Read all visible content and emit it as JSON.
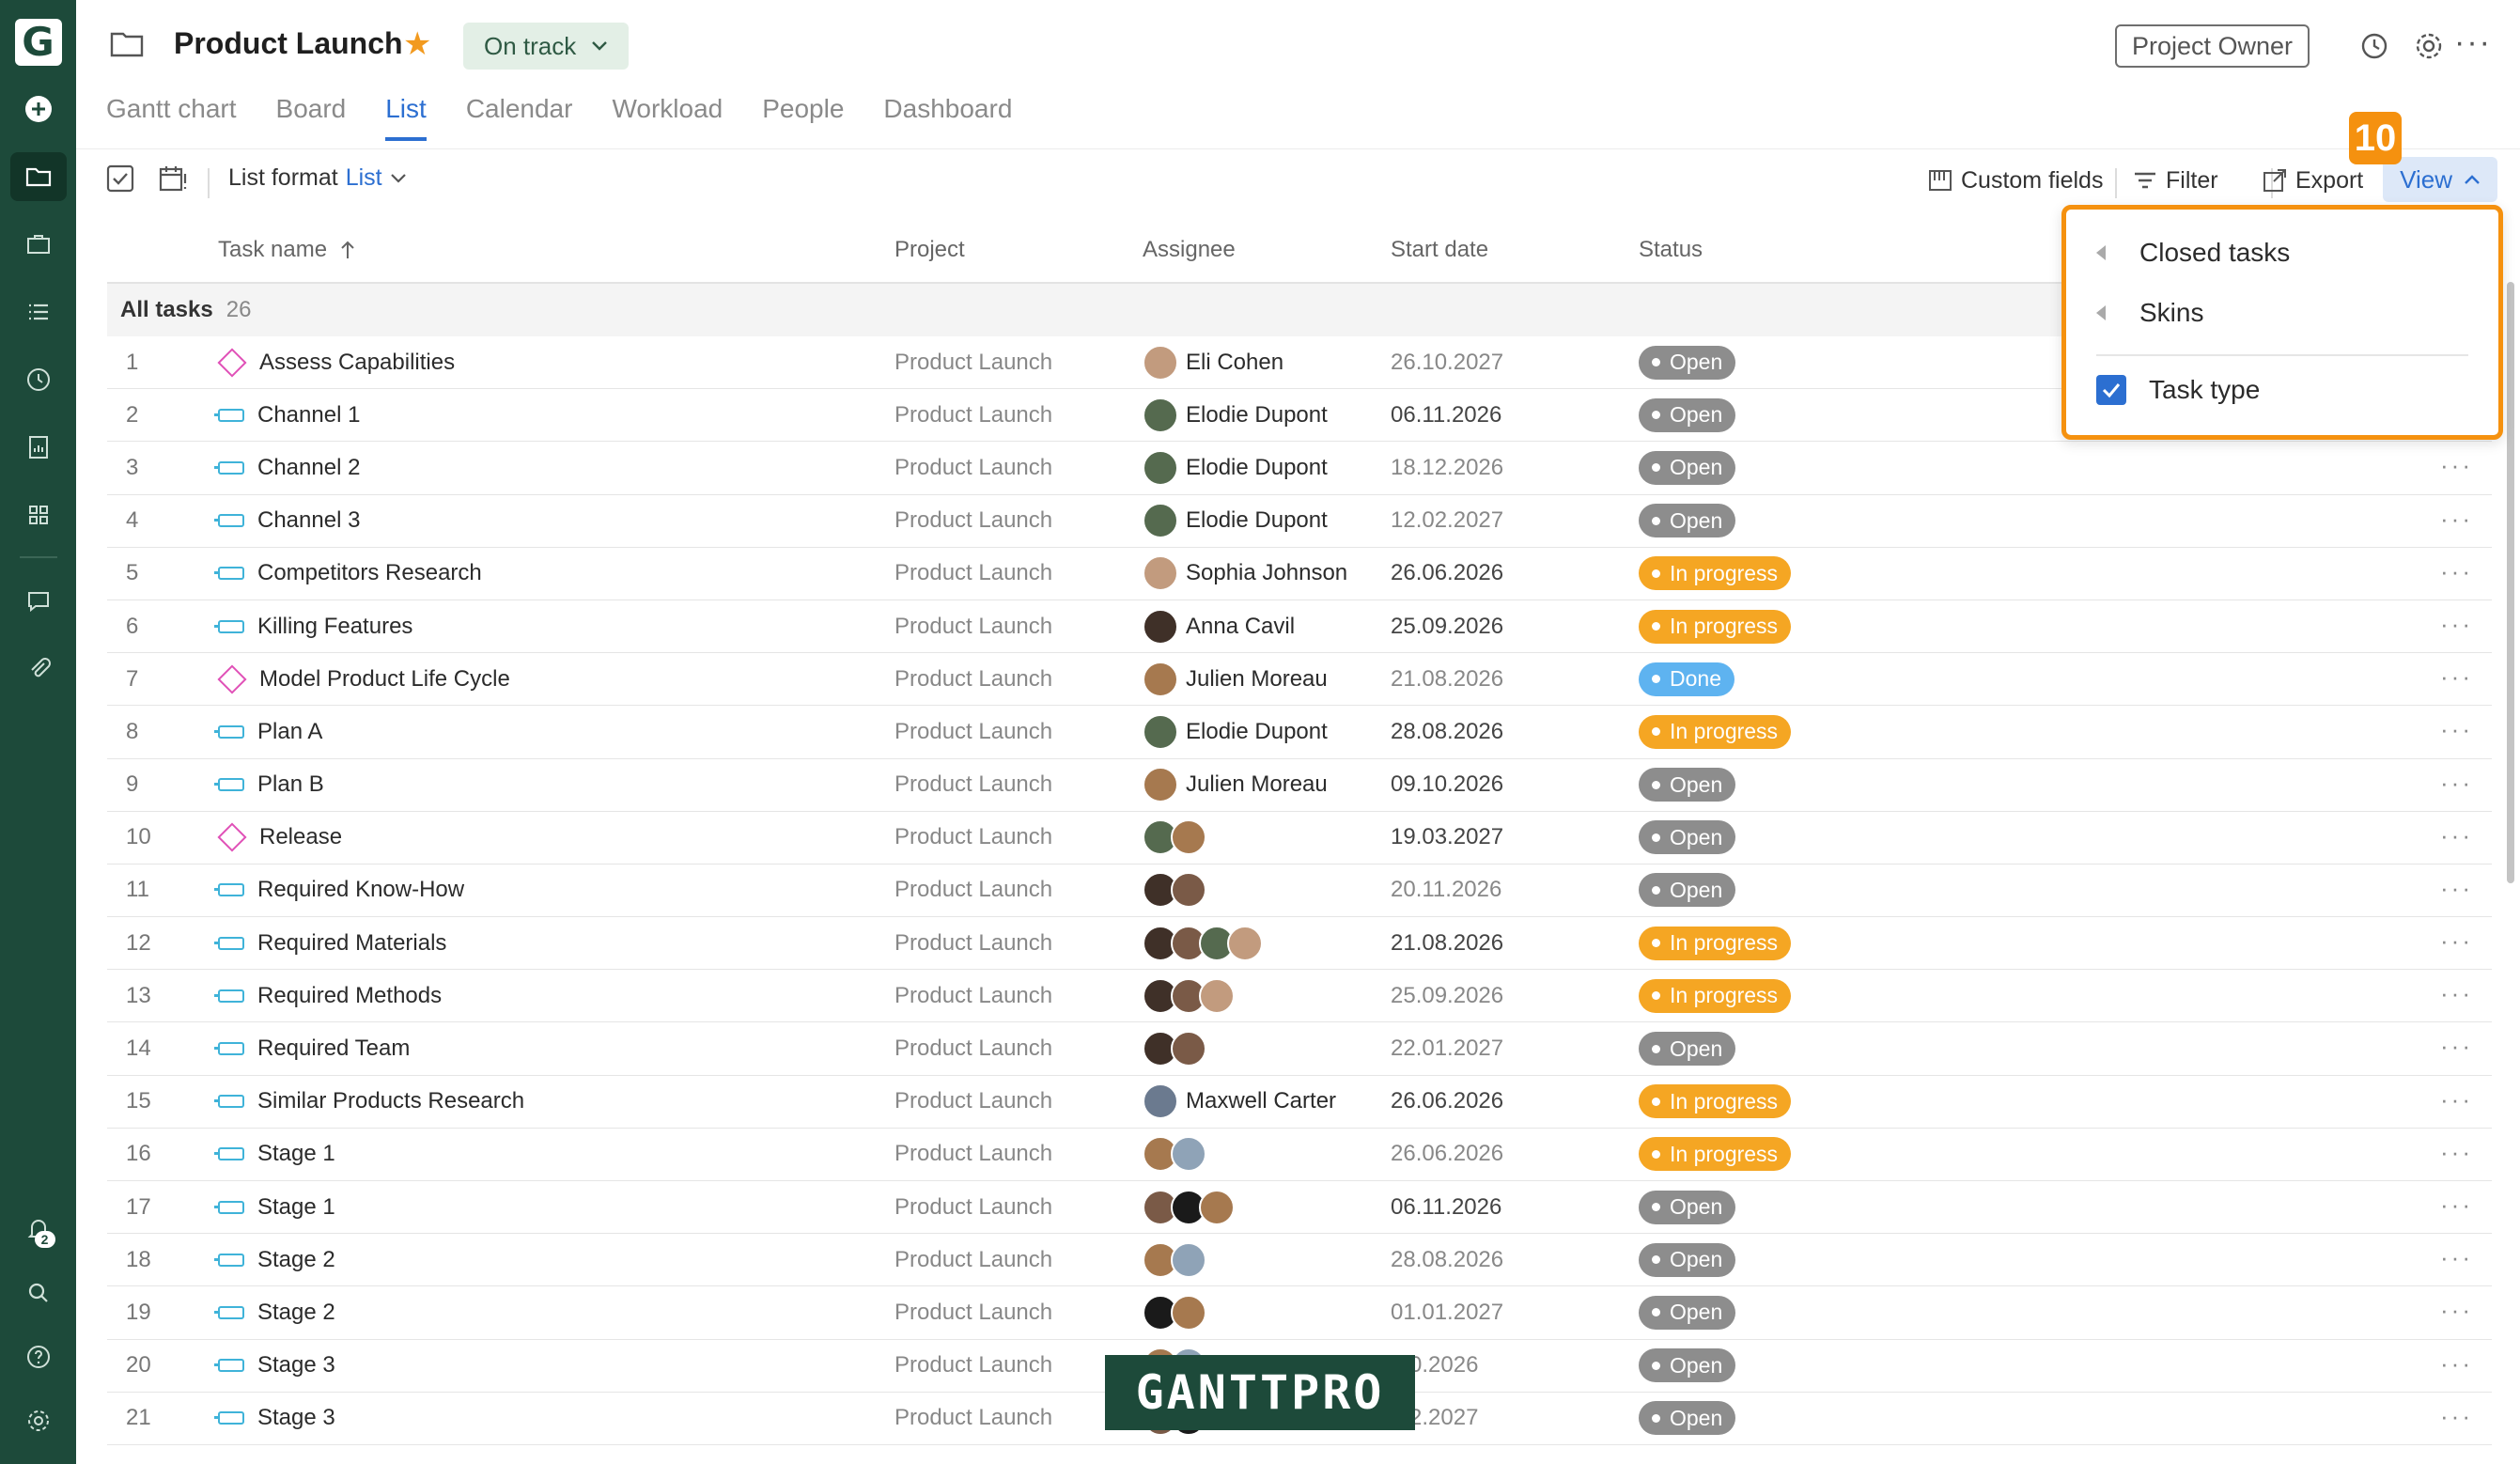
{
  "header": {
    "project_title": "Product Launch",
    "status": "On track",
    "owner_button": "Project Owner"
  },
  "tabs": [
    {
      "label": "Gantt chart",
      "active": false
    },
    {
      "label": "Board",
      "active": false
    },
    {
      "label": "List",
      "active": true
    },
    {
      "label": "Calendar",
      "active": false
    },
    {
      "label": "Workload",
      "active": false
    },
    {
      "label": "People",
      "active": false
    },
    {
      "label": "Dashboard",
      "active": false
    }
  ],
  "toolbar": {
    "list_format_label": "List format",
    "list_format_value": "List",
    "custom_fields": "Custom fields",
    "filter": "Filter",
    "export": "Export",
    "view": "View",
    "step_badge": "10"
  },
  "columns": {
    "task_name": "Task name",
    "project": "Project",
    "assignee": "Assignee",
    "start_date": "Start date",
    "status": "Status"
  },
  "group": {
    "label": "All tasks",
    "count": "26"
  },
  "rows": [
    {
      "num": "1",
      "type": "milestone",
      "name": "Assess Capabilities",
      "project": "Product Launch",
      "assignee": "Eli Cohen",
      "avatars": [
        "a3"
      ],
      "date": "26.10.2027",
      "date_dim": true,
      "status": "Open",
      "status_kind": "open"
    },
    {
      "num": "2",
      "type": "task",
      "name": "Channel 1",
      "project": "Product Launch",
      "assignee": "Elodie Dupont",
      "avatars": [
        "a2"
      ],
      "date": "06.11.2026",
      "date_dim": false,
      "status": "Open",
      "status_kind": "open"
    },
    {
      "num": "3",
      "type": "task",
      "name": "Channel 2",
      "project": "Product Launch",
      "assignee": "Elodie Dupont",
      "avatars": [
        "a2"
      ],
      "date": "18.12.2026",
      "date_dim": true,
      "status": "Open",
      "status_kind": "open"
    },
    {
      "num": "4",
      "type": "task",
      "name": "Channel 3",
      "project": "Product Launch",
      "assignee": "Elodie Dupont",
      "avatars": [
        "a2"
      ],
      "date": "12.02.2027",
      "date_dim": true,
      "status": "Open",
      "status_kind": "open"
    },
    {
      "num": "5",
      "type": "task",
      "name": "Competitors Research",
      "project": "Product Launch",
      "assignee": "Sophia Johnson",
      "avatars": [
        "a3"
      ],
      "date": "26.06.2026",
      "date_dim": false,
      "status": "In progress",
      "status_kind": "progress"
    },
    {
      "num": "6",
      "type": "task",
      "name": "Killing Features",
      "project": "Product Launch",
      "assignee": "Anna Cavil",
      "avatars": [
        "a4"
      ],
      "date": "25.09.2026",
      "date_dim": false,
      "status": "In progress",
      "status_kind": "progress"
    },
    {
      "num": "7",
      "type": "milestone",
      "name": "Model Product Life Cycle",
      "project": "Product Launch",
      "assignee": "Julien Moreau",
      "avatars": [
        "a5"
      ],
      "date": "21.08.2026",
      "date_dim": true,
      "status": "Done",
      "status_kind": "done"
    },
    {
      "num": "8",
      "type": "task",
      "name": "Plan A",
      "project": "Product Launch",
      "assignee": "Elodie Dupont",
      "avatars": [
        "a2"
      ],
      "date": "28.08.2026",
      "date_dim": false,
      "status": "In progress",
      "status_kind": "progress"
    },
    {
      "num": "9",
      "type": "task",
      "name": "Plan B",
      "project": "Product Launch",
      "assignee": "Julien Moreau",
      "avatars": [
        "a5"
      ],
      "date": "09.10.2026",
      "date_dim": false,
      "status": "Open",
      "status_kind": "open"
    },
    {
      "num": "10",
      "type": "milestone",
      "name": "Release",
      "project": "Product Launch",
      "assignee": "",
      "avatars": [
        "a2",
        "a5"
      ],
      "date": "19.03.2027",
      "date_dim": false,
      "status": "Open",
      "status_kind": "open"
    },
    {
      "num": "11",
      "type": "task",
      "name": "Required Know-How",
      "project": "Product Launch",
      "assignee": "",
      "avatars": [
        "a4",
        "a1"
      ],
      "date": "20.11.2026",
      "date_dim": true,
      "status": "Open",
      "status_kind": "open"
    },
    {
      "num": "12",
      "type": "task",
      "name": "Required Materials",
      "project": "Product Launch",
      "assignee": "",
      "avatars": [
        "a4",
        "a1",
        "a2",
        "a3"
      ],
      "date": "21.08.2026",
      "date_dim": false,
      "status": "In progress",
      "status_kind": "progress"
    },
    {
      "num": "13",
      "type": "task",
      "name": "Required Methods",
      "project": "Product Launch",
      "assignee": "",
      "avatars": [
        "a4",
        "a1",
        "a3"
      ],
      "date": "25.09.2026",
      "date_dim": true,
      "status": "In progress",
      "status_kind": "progress"
    },
    {
      "num": "14",
      "type": "task",
      "name": "Required Team",
      "project": "Product Launch",
      "assignee": "",
      "avatars": [
        "a4",
        "a1"
      ],
      "date": "22.01.2027",
      "date_dim": true,
      "status": "Open",
      "status_kind": "open"
    },
    {
      "num": "15",
      "type": "task",
      "name": "Similar Products Research",
      "project": "Product Launch",
      "assignee": "Maxwell Carter",
      "avatars": [
        "a6"
      ],
      "date": "26.06.2026",
      "date_dim": false,
      "status": "In progress",
      "status_kind": "progress"
    },
    {
      "num": "16",
      "type": "task",
      "name": "Stage 1",
      "project": "Product Launch",
      "assignee": "",
      "avatars": [
        "a5",
        "a8"
      ],
      "date": "26.06.2026",
      "date_dim": true,
      "status": "In progress",
      "status_kind": "progress"
    },
    {
      "num": "17",
      "type": "task",
      "name": "Stage 1",
      "project": "Product Launch",
      "assignee": "",
      "avatars": [
        "a1",
        "a7",
        "a5"
      ],
      "date": "06.11.2026",
      "date_dim": false,
      "status": "Open",
      "status_kind": "open"
    },
    {
      "num": "18",
      "type": "task",
      "name": "Stage 2",
      "project": "Product Launch",
      "assignee": "",
      "avatars": [
        "a5",
        "a8"
      ],
      "date": "28.08.2026",
      "date_dim": true,
      "status": "Open",
      "status_kind": "open"
    },
    {
      "num": "19",
      "type": "task",
      "name": "Stage 2",
      "project": "Product Launch",
      "assignee": "",
      "avatars": [
        "a7",
        "a5"
      ],
      "date": "01.01.2027",
      "date_dim": true,
      "status": "Open",
      "status_kind": "open"
    },
    {
      "num": "20",
      "type": "task",
      "name": "Stage 3",
      "project": "Product Launch",
      "assignee": "",
      "avatars": [
        "a5",
        "a8"
      ],
      "date": ".10.2026",
      "date_dim": true,
      "status": "Open",
      "status_kind": "open"
    },
    {
      "num": "21",
      "type": "task",
      "name": "Stage 3",
      "project": "Product Launch",
      "assignee": "",
      "avatars": [
        "a1",
        "a7"
      ],
      "date": ".02.2027",
      "date_dim": true,
      "status": "Open",
      "status_kind": "open"
    }
  ],
  "dropdown": {
    "items": [
      {
        "label": "Closed tasks",
        "kind": "submenu"
      },
      {
        "label": "Skins",
        "kind": "submenu"
      },
      {
        "label": "Task type",
        "kind": "checkbox",
        "checked": true
      }
    ]
  },
  "sidebar": {
    "notification_count": "2"
  },
  "watermark": "GANTTPRO",
  "colors": {
    "sidebar": "#1d4a3a",
    "accent": "#2c6fd1",
    "highlight": "#f5910f",
    "status_open": "#8d8d8d",
    "status_progress": "#f5a623",
    "status_done": "#5eb3f0"
  }
}
